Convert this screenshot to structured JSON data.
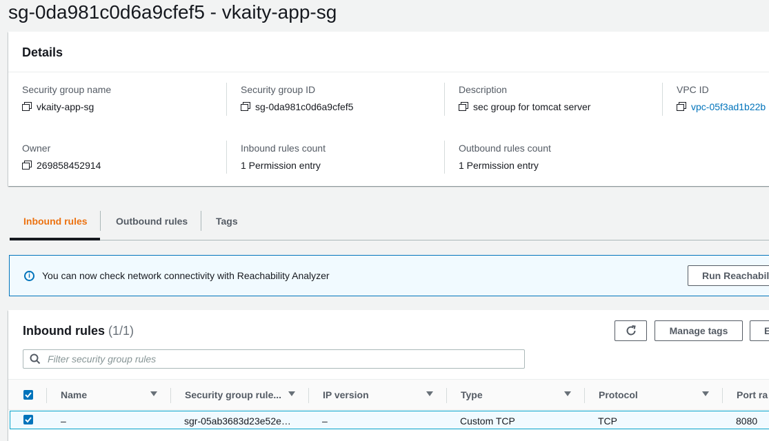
{
  "page": {
    "title": "sg-0da981c0d6a9cfef5 - vkaity-app-sg"
  },
  "details": {
    "heading": "Details",
    "fields": {
      "sg_name": {
        "label": "Security group name",
        "value": "vkaity-app-sg"
      },
      "sg_id": {
        "label": "Security group ID",
        "value": "sg-0da981c0d6a9cfef5"
      },
      "description": {
        "label": "Description",
        "value": "sec group for tomcat server"
      },
      "vpc_id": {
        "label": "VPC ID",
        "value": "vpc-05f3ad1b22b"
      },
      "owner": {
        "label": "Owner",
        "value": "269858452914"
      },
      "inbound_count": {
        "label": "Inbound rules count",
        "value": "1 Permission entry"
      },
      "outbound_count": {
        "label": "Outbound rules count",
        "value": "1 Permission entry"
      }
    }
  },
  "tabs": [
    {
      "label": "Inbound rules",
      "active": true
    },
    {
      "label": "Outbound rules",
      "active": false
    },
    {
      "label": "Tags",
      "active": false
    }
  ],
  "flash": {
    "message": "You can now check network connectivity with Reachability Analyzer",
    "button_label": "Run Reachabil"
  },
  "rules_table": {
    "title": "Inbound rules",
    "count": "(1/1)",
    "manage_tags_label": "Manage tags",
    "edit_label": "E",
    "filter_placeholder": "Filter security group rules",
    "columns": [
      "Name",
      "Security group rule...",
      "IP version",
      "Type",
      "Protocol",
      "Port ra"
    ],
    "rows": [
      {
        "name": "–",
        "rule_id": "sgr-05ab3683d23e52e…",
        "ip_version": "–",
        "type": "Custom TCP",
        "protocol": "TCP",
        "port_range": "8080",
        "selected": true
      }
    ]
  },
  "colors": {
    "accent_orange": "#ec7211",
    "link_blue": "#0073bb",
    "selected_row_bg": "#f1faff",
    "info_border": "#0073bb"
  }
}
